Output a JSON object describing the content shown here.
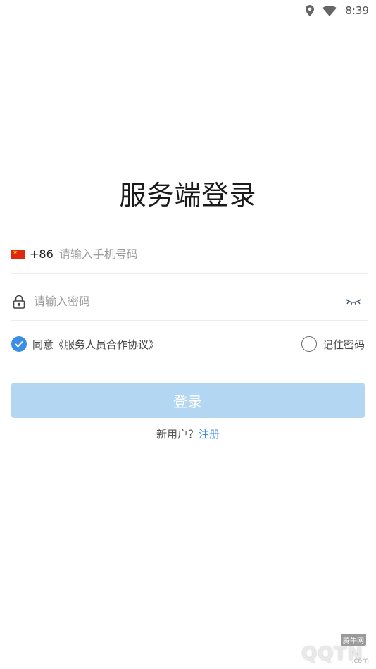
{
  "status_bar": {
    "time": "8:39",
    "icons": [
      "location-icon",
      "wifi-icon"
    ]
  },
  "page": {
    "title": "服务端登录"
  },
  "phone": {
    "country_code": "+86",
    "placeholder": "请输入手机号码",
    "flag_icon": "china-flag-icon"
  },
  "password": {
    "placeholder": "请输入密码",
    "lock_icon": "lock-icon",
    "eye_icon": "eye-closed-icon"
  },
  "options": {
    "agree_label": "同意《服务人员合作协议》",
    "agree_checked": true,
    "remember_label": "记住密码",
    "remember_checked": false
  },
  "login_button": {
    "label": "登录"
  },
  "register": {
    "prompt": "新用户？",
    "link": "注册"
  },
  "watermark": {
    "small": "腾牛网",
    "main": "QQTN",
    "suffix": ".com"
  },
  "colors": {
    "accent": "#3a8ee6",
    "button_disabled": "#b3d6f3",
    "flag_red": "#de2910",
    "flag_yellow": "#ffde00"
  }
}
